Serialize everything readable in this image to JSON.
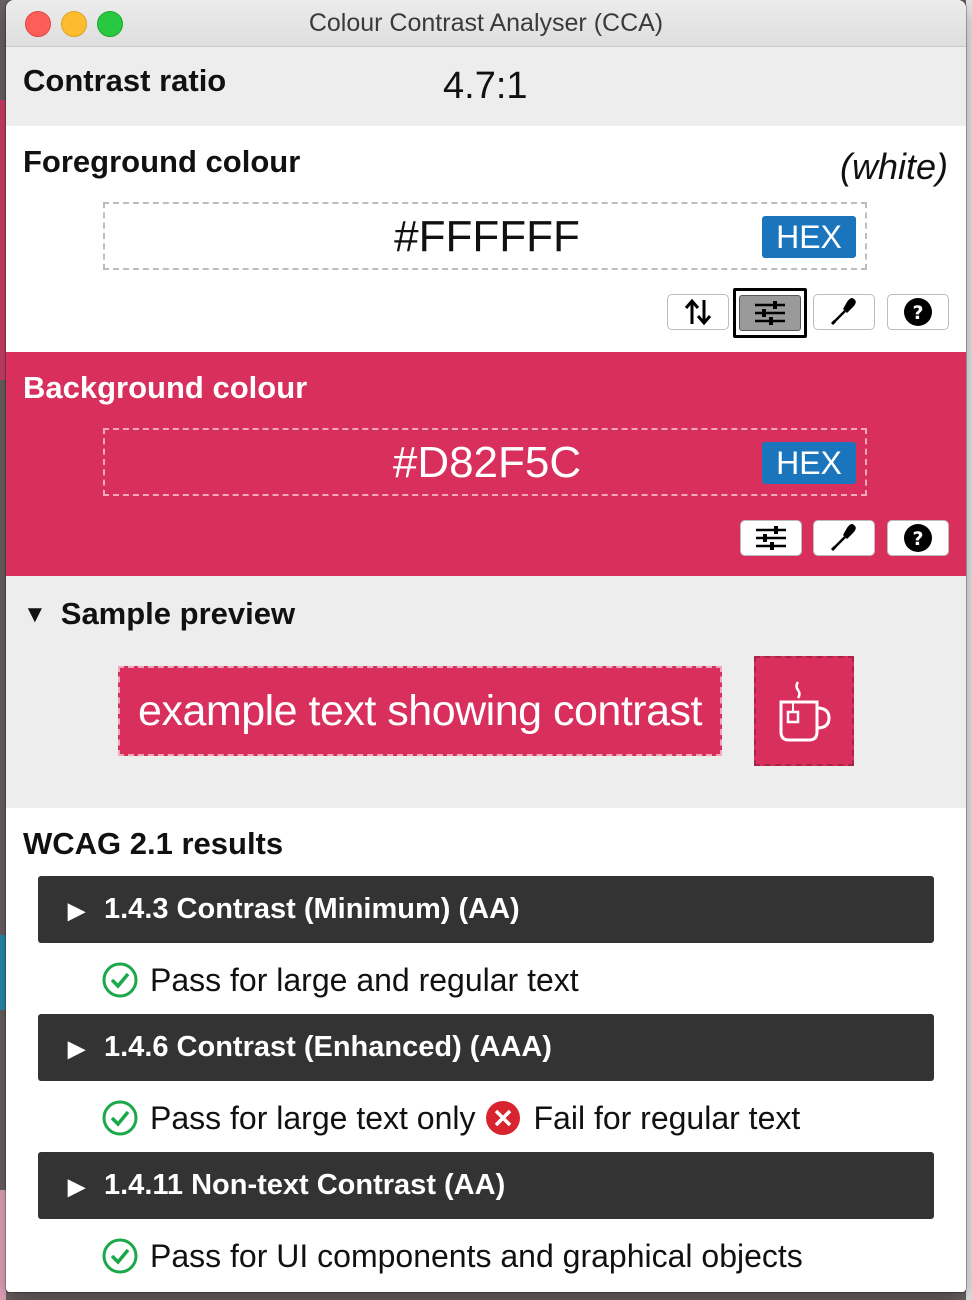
{
  "window": {
    "title": "Colour Contrast Analyser (CCA)"
  },
  "contrast": {
    "label": "Contrast ratio",
    "value": "4.7:1"
  },
  "foreground": {
    "label": "Foreground colour",
    "name": "(white)",
    "hex": "#FFFFFF",
    "format_button": "HEX",
    "tools": [
      "swap-icon",
      "sliders-icon",
      "eyedropper-icon",
      "help-icon"
    ]
  },
  "background": {
    "label": "Background colour",
    "hex": "#D82F5C",
    "format_button": "HEX",
    "tools": [
      "sliders-icon",
      "eyedropper-icon",
      "help-icon"
    ]
  },
  "preview": {
    "label": "Sample preview",
    "sample_text": "example text showing contrast",
    "icon": "coffee-mug-icon"
  },
  "wcag": {
    "label": "WCAG 2.1 results",
    "criteria": [
      {
        "label": "1.4.3 Contrast (Minimum) (AA)",
        "results": [
          {
            "status": "pass",
            "text": "Pass for large and regular text"
          }
        ]
      },
      {
        "label": "1.4.6 Contrast (Enhanced) (AAA)",
        "results": [
          {
            "status": "pass",
            "text": "Pass for large text only"
          },
          {
            "status": "fail",
            "text": "Fail for regular text"
          }
        ]
      },
      {
        "label": "1.4.11 Non-text Contrast (AA)",
        "results": [
          {
            "status": "pass",
            "text": "Pass for UI components and graphical objects"
          }
        ]
      }
    ]
  },
  "colors": {
    "background": "#D82F5C",
    "foreground": "#FFFFFF",
    "accent_blue": "#1B75BC",
    "pass_green": "#1AA84A",
    "fail_red": "#D7242F",
    "criteria_bar": "#333333"
  }
}
